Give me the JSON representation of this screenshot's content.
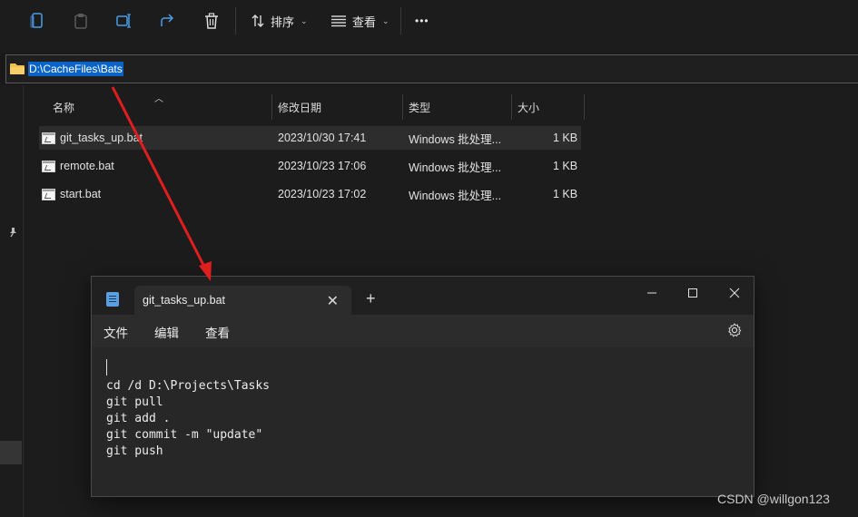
{
  "toolbar": {
    "sort_label": "排序",
    "view_label": "查看",
    "more_label": "•••"
  },
  "address": {
    "path": "D:\\CacheFiles\\Bats"
  },
  "columns": {
    "name": "名称",
    "modified": "修改日期",
    "type": "类型",
    "size": "大小"
  },
  "files": [
    {
      "name": "git_tasks_up.bat",
      "modified": "2023/10/30 17:41",
      "type": "Windows 批处理...",
      "size": "1 KB",
      "selected": true
    },
    {
      "name": "remote.bat",
      "modified": "2023/10/23 17:06",
      "type": "Windows 批处理...",
      "size": "1 KB",
      "selected": false
    },
    {
      "name": "start.bat",
      "modified": "2023/10/23 17:02",
      "type": "Windows 批处理...",
      "size": "1 KB",
      "selected": false
    }
  ],
  "notepad": {
    "tab_title": "git_tasks_up.bat",
    "menu": [
      "文件",
      "编辑",
      "查看"
    ],
    "content": "cd /d D:\\Projects\\Tasks\ngit pull\ngit add .\ngit commit -m \"update\"\ngit push"
  },
  "watermark": "CSDN @willgon123",
  "colors": {
    "accent_selection": "#0a64c8",
    "arrow": "#e01e1e"
  }
}
